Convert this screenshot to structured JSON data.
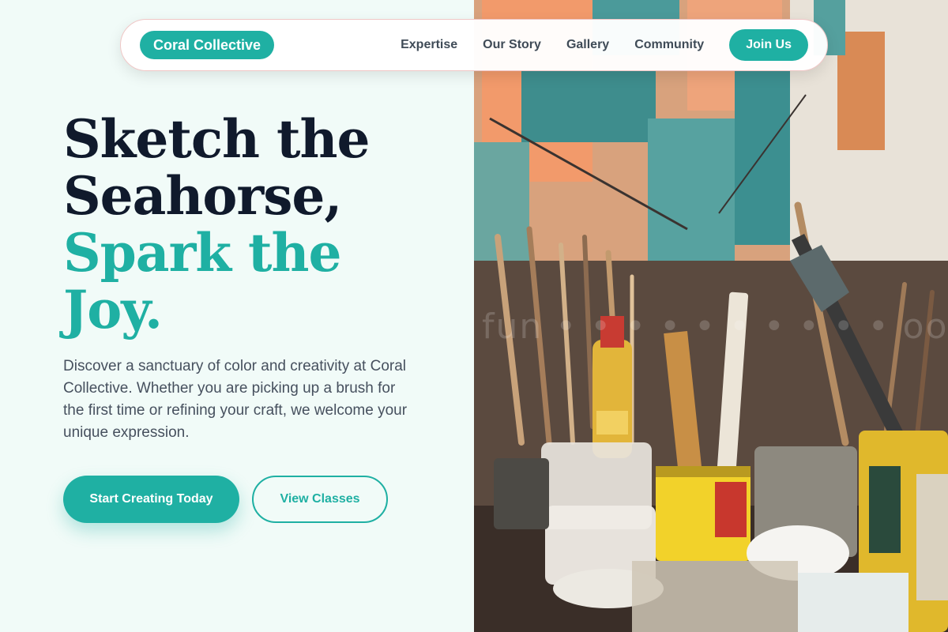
{
  "nav": {
    "brand": "Coral Collective",
    "links": [
      "Expertise",
      "Our Story",
      "Gallery",
      "Community"
    ],
    "cta": "Join Us"
  },
  "hero": {
    "headline_dark_1": "Sketch the",
    "headline_dark_2": "Seahorse,",
    "headline_teal_1": "Spark the",
    "headline_teal_2": "Joy.",
    "description": "Discover a sanctuary of color and creativity at Coral Collective. Whether you are picking up a brush for the first time or refining your craft, we welcome your unique expression.",
    "primary_cta": "Start Creating Today",
    "secondary_cta": "View Classes"
  },
  "image": {
    "subject": "art-studio-brushes-and-paint-cans"
  },
  "colors": {
    "accent": "#1fb0a3",
    "heading": "#101a2c",
    "body_text": "#46505e",
    "background": "#f1fbf8"
  }
}
